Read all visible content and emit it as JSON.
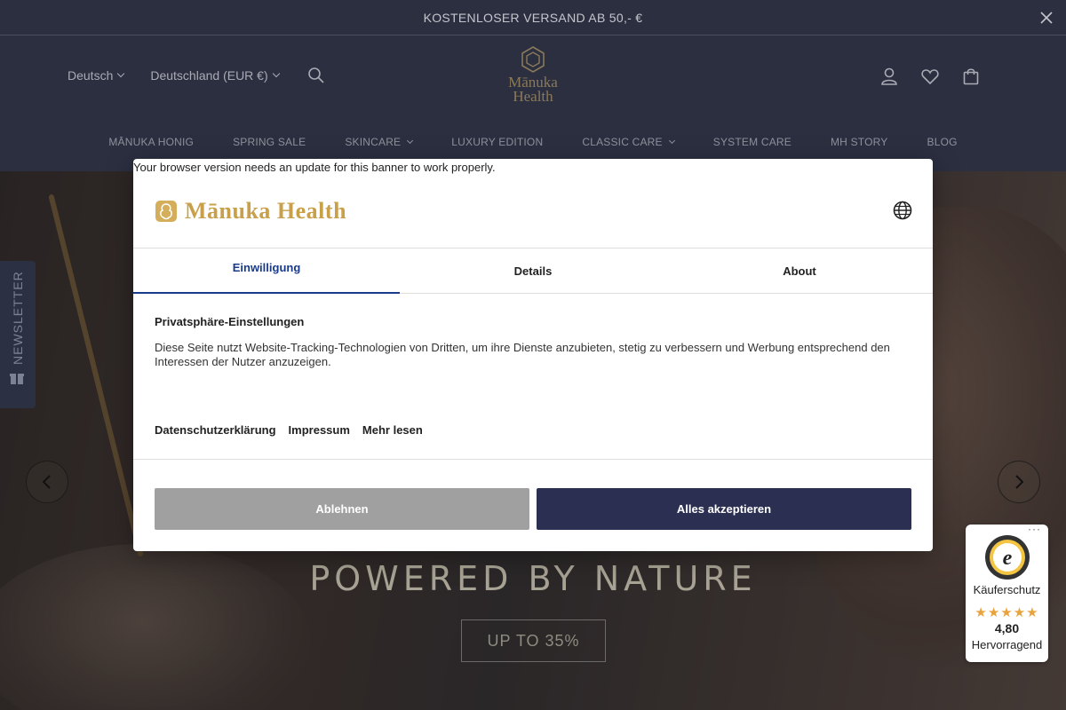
{
  "announcement": {
    "text": "KOSTENLOSER VERSAND AB 50,- €"
  },
  "header": {
    "language": "Deutsch",
    "region": "Deutschland (EUR €)",
    "logo_line1": "Mānuka",
    "logo_line2": "Health",
    "nav": [
      {
        "label": "MĀNUKA HONIG",
        "has_dropdown": false
      },
      {
        "label": "SPRING SALE",
        "has_dropdown": false
      },
      {
        "label": "SKINCARE",
        "has_dropdown": true
      },
      {
        "label": "LUXURY EDITION",
        "has_dropdown": false
      },
      {
        "label": "CLASSIC CARE",
        "has_dropdown": true
      },
      {
        "label": "SYSTEM CARE",
        "has_dropdown": false
      },
      {
        "label": "MH STORY",
        "has_dropdown": false
      },
      {
        "label": "BLOG",
        "has_dropdown": false
      }
    ]
  },
  "hero": {
    "tagline": "POWERED BY NATURE",
    "cta_label": "UP TO 35%"
  },
  "newsletter": {
    "label": "NEWSLETTER"
  },
  "cookie_dialog": {
    "update_notice": "Your browser version needs an update for this banner to work properly.",
    "brand": "Mānuka Health",
    "tabs": [
      {
        "label": "Einwilligung",
        "active": true
      },
      {
        "label": "Details",
        "active": false
      },
      {
        "label": "About",
        "active": false
      }
    ],
    "privacy_title": "Privatsphäre-Einstellungen",
    "privacy_text": "Diese Seite nutzt Website-Tracking-Technologien von Dritten, um ihre Dienste anzubieten, stetig zu verbessern und Werbung entsprechend den Interessen der Nutzer anzuzeigen.",
    "links": [
      "Datenschutzerklärung",
      "Impressum",
      "Mehr lesen"
    ],
    "deny_label": "Ablehnen",
    "accept_label": "Alles akzeptieren",
    "colors": {
      "accent": "#1a3a8a",
      "accept_bg": "#2b3052",
      "deny_bg": "#a0a0a0",
      "brand_gold": "#c9a04a"
    }
  },
  "trusted_shops": {
    "label": "Käuferschutz",
    "stars": "★★★★★",
    "rating": "4,80",
    "verdict": "Hervorragend",
    "more": "···"
  }
}
